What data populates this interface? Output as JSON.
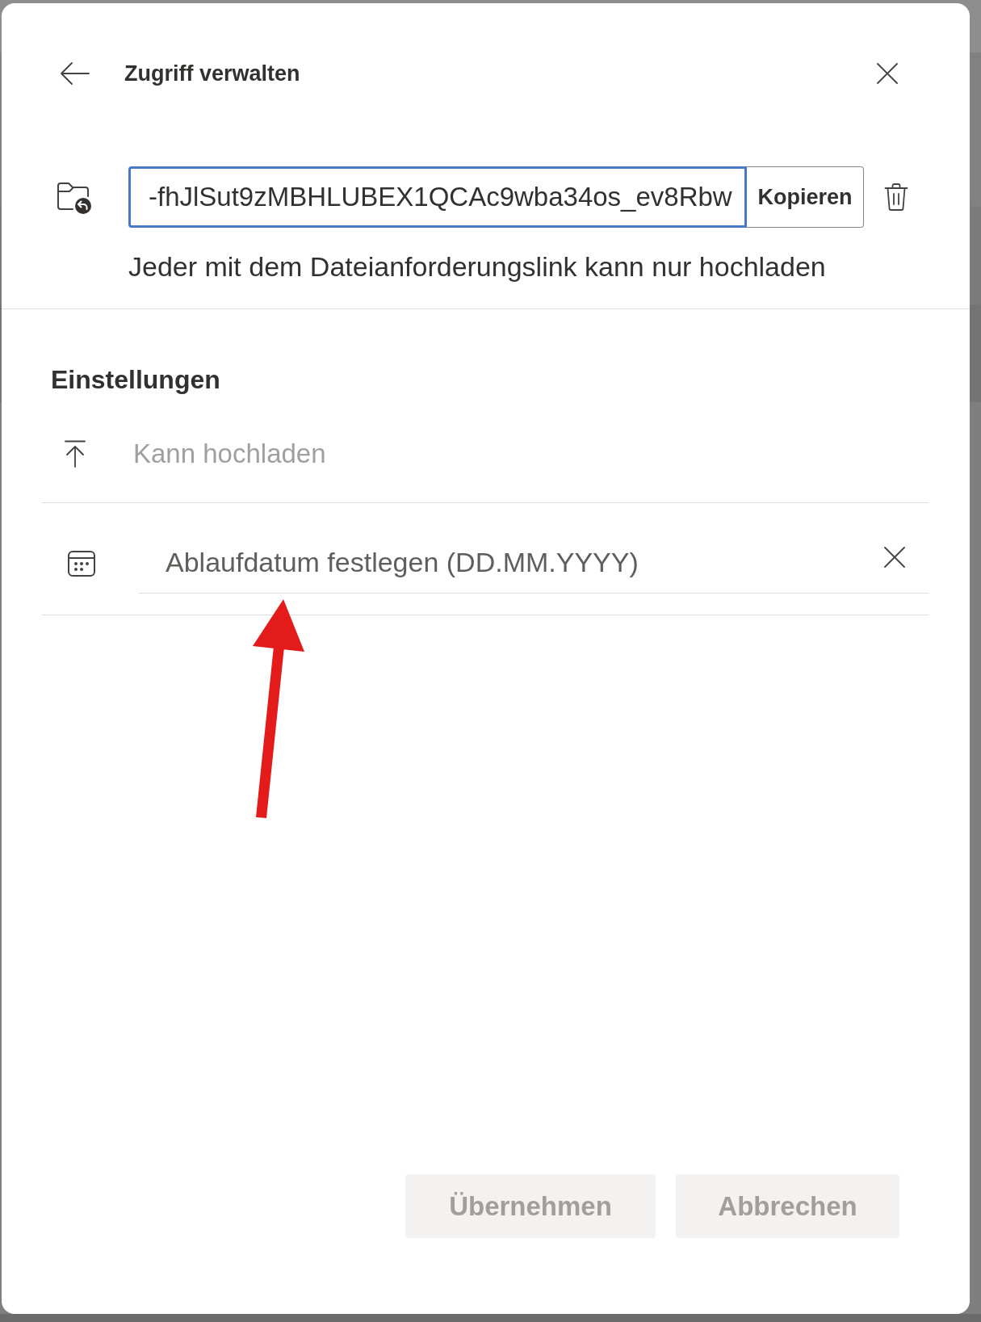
{
  "dialog": {
    "title": "Zugriff verwalten"
  },
  "link": {
    "value": "-fhJlSut9zMBHLUBEX1QCAc9wba34os_ev8Rbw",
    "focused": true,
    "copy_button": "Kopieren",
    "description": "Jeder mit dem Dateianforderungslink kann nur hochladen"
  },
  "settings": {
    "heading": "Einstellungen",
    "items": [
      {
        "kind": "permission",
        "label": "Kann hochladen",
        "disabled": true
      },
      {
        "kind": "date",
        "placeholder": "Ablaufdatum festlegen (DD.MM.YYYY)"
      }
    ]
  },
  "buttons": [
    {
      "label": "Übernehmen",
      "disabled": true
    },
    {
      "label": "Abbrechen",
      "disabled": true
    }
  ],
  "annotations": [
    {
      "kind": "arrow"
    }
  ]
}
